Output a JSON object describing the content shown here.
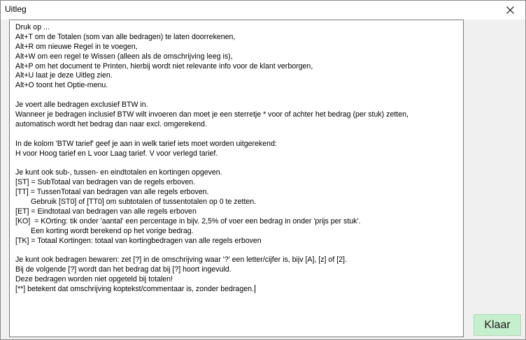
{
  "window": {
    "title": "Uitleg",
    "close_icon": "close-icon"
  },
  "help_lines": [
    "Druk op ...",
    "Alt+T om de Totalen (som van alle bedragen) te laten doorrekenen,",
    "Alt+R om nieuwe Regel in te voegen,",
    "Alt+W om een regel te Wissen (alleen als de omschrijving leeg is),",
    "Alt+P om het document te Printen, hierbij wordt niet relevante info voor de klant verborgen,",
    "Alt+U laat je deze Uitleg zien.",
    "Alt+O toont het Optie-menu.",
    "",
    "Je voert alle bedragen exclusief BTW in.",
    "Wanneer je bedragen inclusief BTW wilt invoeren dan moet je een sterretje * voor of achter het bedrag (per stuk) zetten,",
    "automatisch wordt het bedrag dan naar excl. omgerekend.",
    "",
    "In de kolom 'BTW tarief' geef je aan in welk tarief iets moet worden uitgerekend:",
    "H voor Hoog tarief en L voor Laag tarief. V voor verlegd tarief.",
    "",
    "Je kunt ook sub-, tussen- en eindtotalen en kortingen opgeven.",
    "[ST] = SubTotaal van bedragen van de regels erboven.",
    "[TT] = TussenTotaal van bedragen van alle regels erboven.",
    "Gebruik [ST0] of [TT0] om subtotalen of tussentotalen op 0 te zetten.",
    "[ET] = Eindtotaal van bedragen van alle regels erboven",
    "[KO]  = KOrting: tik onder 'aantal' een percentage in bijv. 2,5% of voer een bedrag in onder 'prijs per stuk'.",
    "Een korting wordt berekend op het vorige bedrag.",
    "[TK] = Totaal Kortingen: totaal van kortingbedragen van alle regels erboven",
    "",
    "Je kunt ook bedragen bewaren: zet [?] in de omschrijving waar '?' een letter/cijfer is, bijv [A], [z] of [2].",
    "Bij de volgende [?] wordt dan het bedrag dat bij [?] hoort ingevuld.",
    "Deze bedragen worden niet opgeteld bij totalen!",
    "[**] betekent dat omschrijving koptekst/commentaar is, zonder bedragen."
  ],
  "buttons": {
    "ok_label": "Klaar",
    "ok_color": "#c6efce"
  }
}
